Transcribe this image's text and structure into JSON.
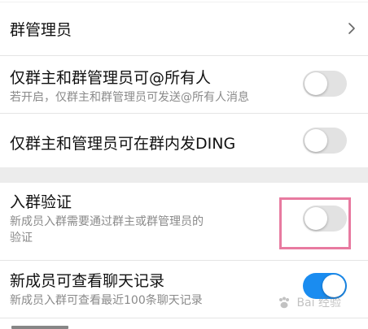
{
  "settings": {
    "admins": {
      "title": "群管理员"
    },
    "at_all": {
      "title": "仅群主和群管理员可@所有人",
      "subtitle": "若开启，仅群主和群管理员可发送@所有人消息",
      "enabled": false
    },
    "ding": {
      "title": "仅群主和管理员可在群内发DING",
      "enabled": false
    },
    "join_verify": {
      "title": "入群验证",
      "subtitle_line1": "新成员入群需要通过群主或群管理员的",
      "subtitle_line2": "验证",
      "enabled": false
    },
    "history": {
      "title": "新成员可查看聊天记录",
      "subtitle": "新成员入群可查看最近100条聊天记录",
      "enabled": true
    }
  },
  "colors": {
    "toggle_on": "#1a8cf0",
    "toggle_off": "#e2e2e2",
    "highlight": "#e87aa0"
  },
  "watermark": {
    "text": "Bai 经验"
  }
}
